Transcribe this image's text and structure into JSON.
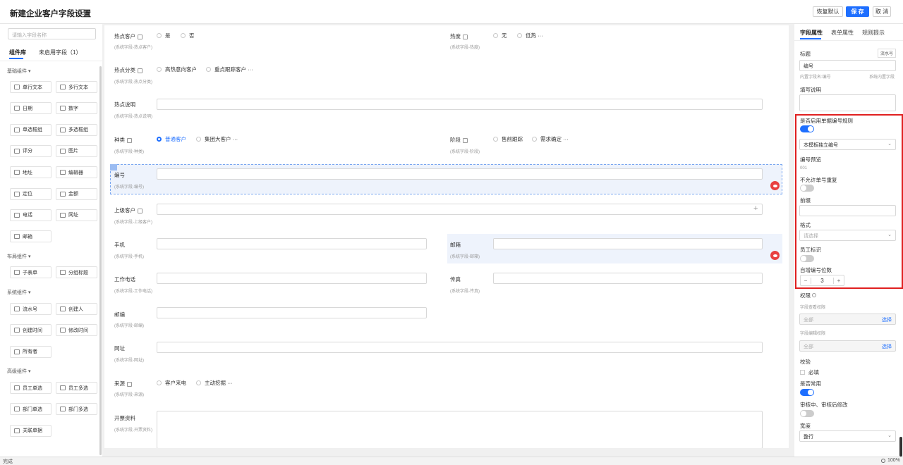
{
  "header": {
    "title": "新建企业客户字段设置",
    "restore": "恢复默认",
    "save": "保 存",
    "cancel": "取 消"
  },
  "left": {
    "search_placeholder": "请输入字段名称",
    "tab_lib": "组件库",
    "tab_unused": "未启用字段（1）",
    "sections": {
      "basic": "基础组件",
      "layout": "布局组件",
      "system": "系统组件",
      "advanced": "高级组件"
    },
    "basic": [
      {
        "label": "单行文本",
        "icon": "single-line-text-icon"
      },
      {
        "label": "多行文本",
        "icon": "multi-line-text-icon"
      },
      {
        "label": "日期",
        "icon": "calendar-icon"
      },
      {
        "label": "数字",
        "icon": "number-icon"
      },
      {
        "label": "单选框组",
        "icon": "radio-icon"
      },
      {
        "label": "多选框组",
        "icon": "checkbox-icon"
      },
      {
        "label": "评分",
        "icon": "star-icon"
      },
      {
        "label": "图片",
        "icon": "image-icon"
      },
      {
        "label": "地址",
        "icon": "location-icon"
      },
      {
        "label": "编辑器",
        "icon": "editor-icon"
      },
      {
        "label": "定位",
        "icon": "pin-icon"
      },
      {
        "label": "金额",
        "icon": "money-icon"
      },
      {
        "label": "电话",
        "icon": "phone-icon"
      },
      {
        "label": "网址",
        "icon": "globe-icon"
      },
      {
        "label": "邮箱",
        "icon": "mail-icon"
      }
    ],
    "layout": [
      {
        "label": "子表单",
        "icon": "subform-icon"
      },
      {
        "label": "分组标题",
        "icon": "group-title-icon"
      }
    ],
    "system": [
      {
        "label": "流水号",
        "icon": "serial-icon"
      },
      {
        "label": "创建人",
        "icon": "user-icon"
      },
      {
        "label": "创建时间",
        "icon": "clock-icon"
      },
      {
        "label": "修改时间",
        "icon": "clock-icon"
      },
      {
        "label": "所有者",
        "icon": "owner-icon"
      }
    ],
    "advanced": [
      {
        "label": "员工单选",
        "icon": "employee-icon"
      },
      {
        "label": "员工多选",
        "icon": "employees-icon"
      },
      {
        "label": "部门单选",
        "icon": "department-icon"
      },
      {
        "label": "部门多选",
        "icon": "departments-icon"
      },
      {
        "label": "关联单据",
        "icon": "link-doc-icon"
      }
    ]
  },
  "form": {
    "hot_customer": {
      "label": "热点客户",
      "sub": "(系统字段-热点客户)",
      "opt1": "是",
      "opt2": "否"
    },
    "heat": {
      "label": "热度",
      "sub": "(系统字段-热度)",
      "opt1": "无",
      "opt2": "低热 ···"
    },
    "hot_category": {
      "label": "热点分类",
      "sub": "(系统字段-热点分类)",
      "opt1": "高热意向客户",
      "opt2": "重点跟踪客户 ···"
    },
    "hot_desc": {
      "label": "热点说明",
      "sub": "(系统字段-热点说明)"
    },
    "kind": {
      "label": "种类",
      "sub": "(系统字段-种类)",
      "opt1": "普通客户",
      "opt2": "集团大客户 ···"
    },
    "stage": {
      "label": "阶段",
      "sub": "(系统字段-阶段)",
      "opt1": "售前跟踪",
      "opt2": "需求确定 ···"
    },
    "serial": {
      "label": "编号",
      "sub": "(系统字段-编号)"
    },
    "parent": {
      "label": "上级客户",
      "sub": "(系统字段-上级客户)"
    },
    "mobile": {
      "label": "手机",
      "sub": "(系统字段-手机)"
    },
    "email": {
      "label": "邮箱",
      "sub": "(系统字段-邮箱)"
    },
    "work_phone": {
      "label": "工作电话",
      "sub": "(系统字段-工作电话)"
    },
    "fax": {
      "label": "传真",
      "sub": "(系统字段-传真)"
    },
    "zip": {
      "label": "邮编",
      "sub": "(系统字段-邮编)"
    },
    "website": {
      "label": "网址",
      "sub": "(系统字段-网址)"
    },
    "source": {
      "label": "来源",
      "sub": "(系统字段-来源)",
      "opt1": "客户来电",
      "opt2": "主动挖掘 ···"
    },
    "invoice": {
      "label": "开票资料",
      "sub": "(系统字段-开票资料)"
    }
  },
  "right": {
    "tabs": [
      "字段属性",
      "表单属性",
      "规则提示"
    ],
    "title_label": "标题",
    "title_badge": "流水号",
    "title_value": "编号",
    "inner_name": "内置字段名:编号",
    "builtin": "系统内置字段",
    "fill_desc": "填写说明",
    "use_rule": "是否启用单据编号规则",
    "rule_select": "本模板独立编号",
    "preview_label": "编号预览",
    "preview_value": "001",
    "no_dup": "不允许单号重复",
    "prefix": "前缀",
    "format": "格式",
    "format_placeholder": "请选择",
    "staff_id": "员工标识",
    "digits_label": "自增编号位数",
    "digits_value": "3",
    "perm": "权限",
    "view_perm": "字段查看权限",
    "all1": "全部",
    "choose1": "选择",
    "edit_perm": "字段编辑权限",
    "all2": "全部",
    "choose2": "选择",
    "validate": "校验",
    "required": "必填",
    "common": "是否常用",
    "audit": "审核中、审核后修改",
    "width": "宽度",
    "width_value": "整行"
  },
  "status": {
    "left": "完成",
    "zoom": "100%"
  }
}
